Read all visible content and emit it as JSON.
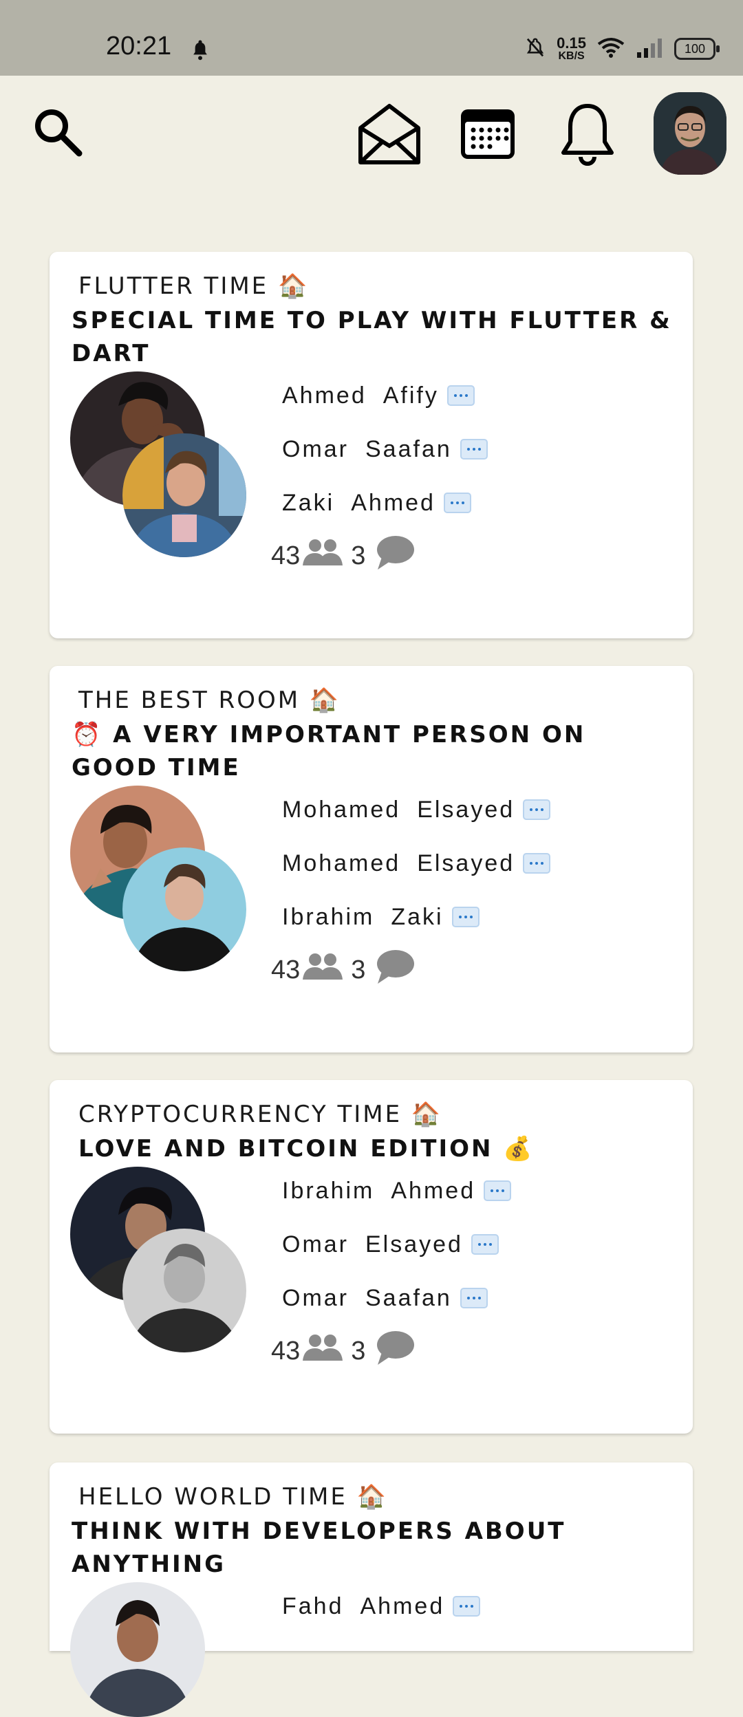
{
  "status_bar": {
    "time": "20:21",
    "speed_value": "0.15",
    "speed_unit": "KB/S",
    "battery": "100"
  },
  "app_bar": {
    "icons": [
      "search-icon",
      "mail-icon",
      "calendar-icon",
      "bell-icon"
    ],
    "profile_avatar": "profile-avatar"
  },
  "rooms": [
    {
      "topic": "FLUTTER TIME 🏠",
      "title": " SPECIAL TIME TO PLAY WITH FLUTTER & DART",
      "speakers": [
        {
          "first": "Ahmed",
          "last": "Afify"
        },
        {
          "first": "Omar",
          "last": "Saafan"
        },
        {
          "first": "Zaki",
          "last": "Ahmed"
        }
      ],
      "listeners": "43",
      "messages": "3"
    },
    {
      "topic": "THE BEST ROOM 🏠",
      "title": "⏰ A VERY IMPORTANT PERSON ON GOOD TIME",
      "speakers": [
        {
          "first": "Mohamed",
          "last": "Elsayed"
        },
        {
          "first": "Mohamed",
          "last": "Elsayed"
        },
        {
          "first": "Ibrahim",
          "last": "Zaki"
        }
      ],
      "listeners": "43",
      "messages": "3"
    },
    {
      "topic": "CRYPTOCURRENCY TIME 🏠",
      "title": "LOVE AND BITCOIN EDITION 💰",
      "speakers": [
        {
          "first": "Ibrahim",
          "last": "Ahmed"
        },
        {
          "first": "Omar",
          "last": "Elsayed"
        },
        {
          "first": "Omar",
          "last": "Saafan"
        }
      ],
      "listeners": "43",
      "messages": "3"
    },
    {
      "topic": "HELLO WORLD TIME 🏠",
      "title": " THINK WITH DEVELOPERS ABOUT ANYTHING",
      "speakers": [
        {
          "first": "Fahd",
          "last": "Ahmed"
        }
      ]
    }
  ],
  "colors": {
    "background": "#f1efe4",
    "status_bar": "#b3b2a7",
    "card": "#ffffff",
    "icon_grey": "#8a8a8a"
  }
}
